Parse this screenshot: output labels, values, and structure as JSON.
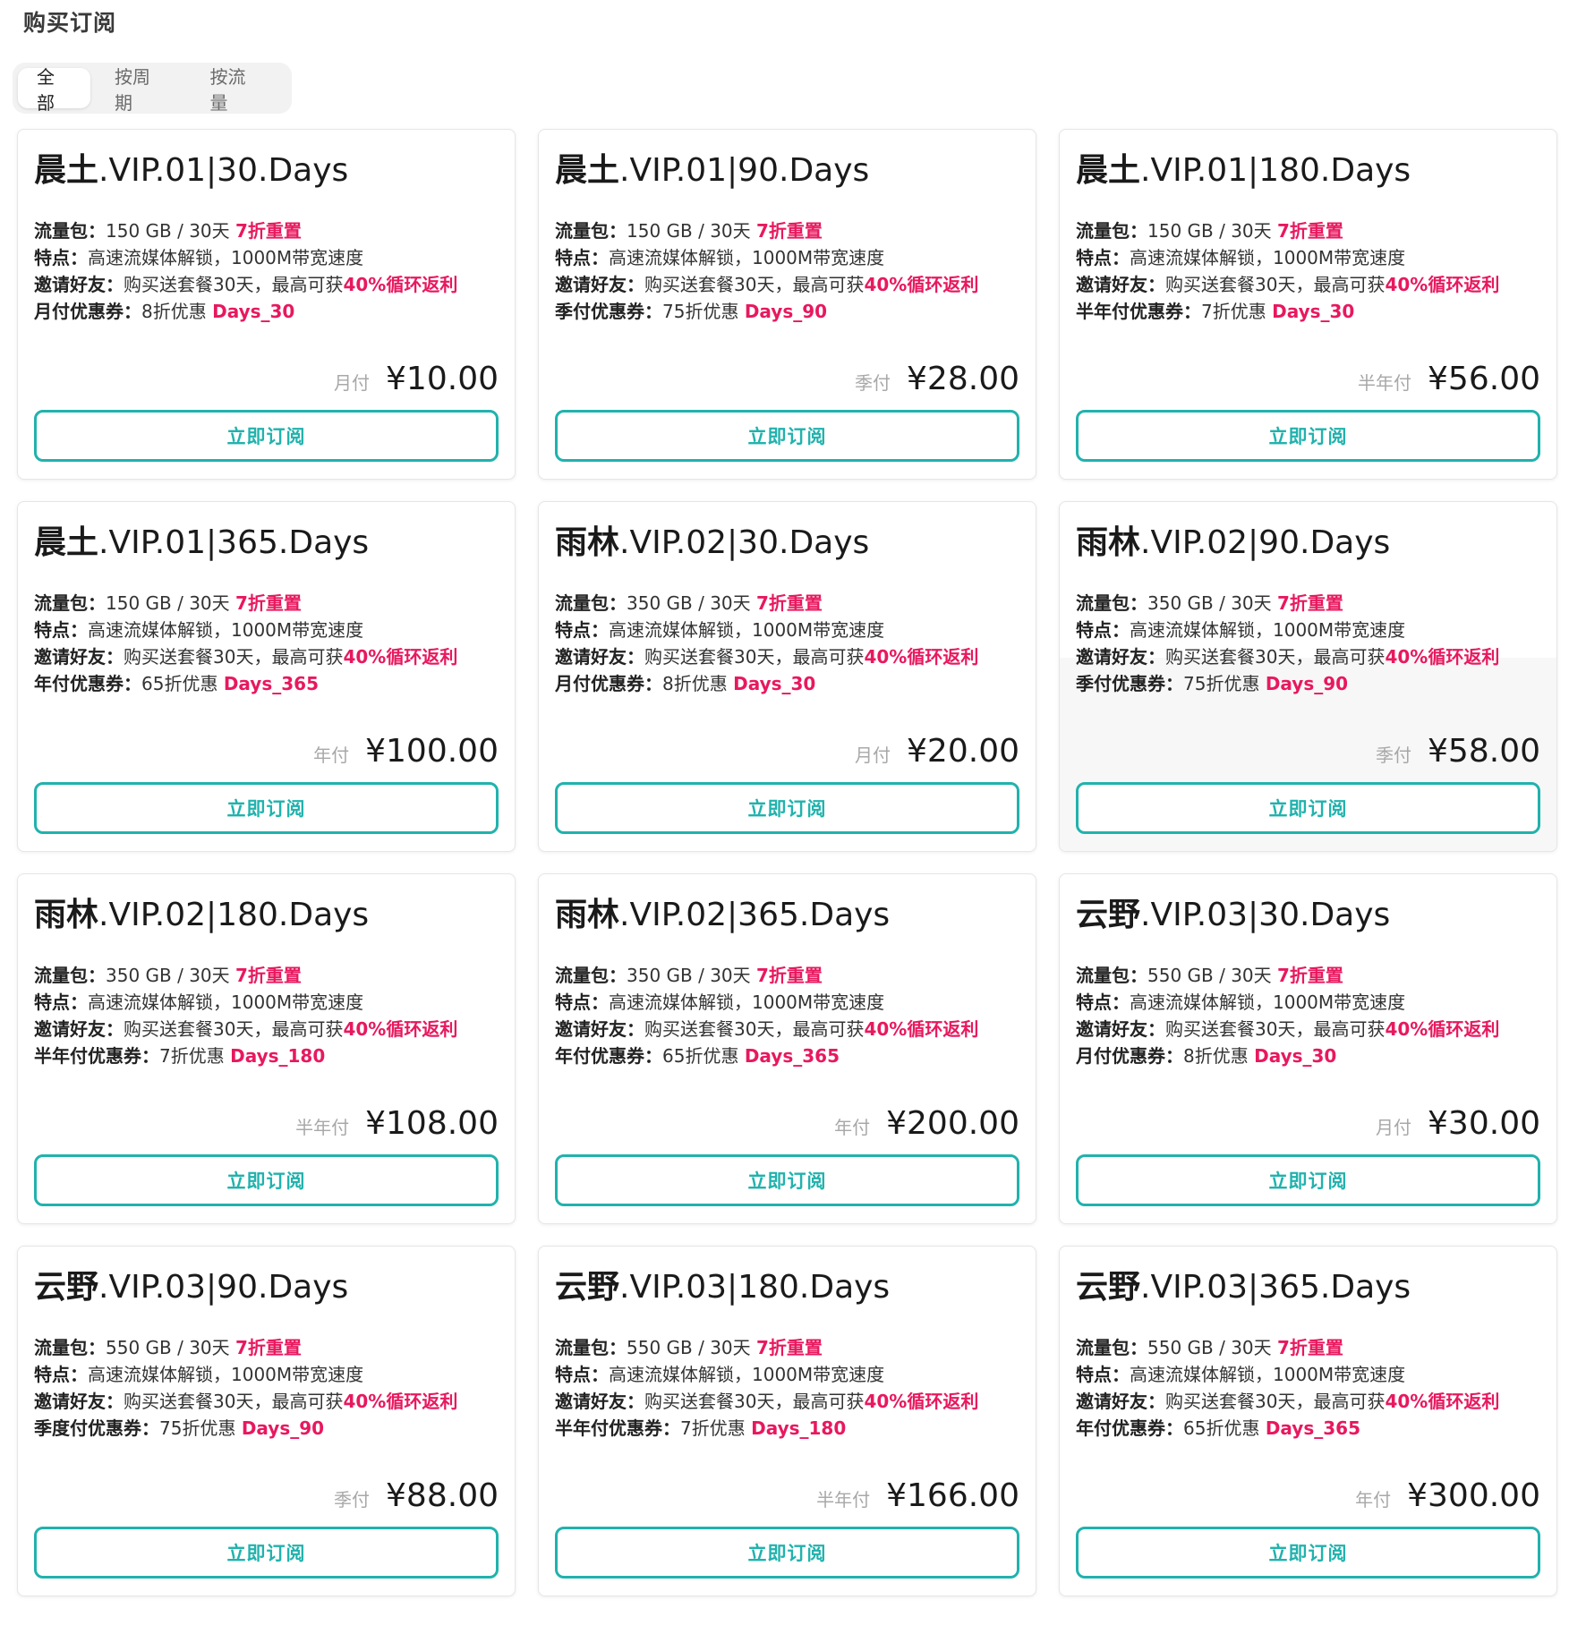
{
  "page": {
    "title": "购买订阅"
  },
  "tabs": [
    {
      "label": "全部",
      "active": true
    },
    {
      "label": "按周期",
      "active": false
    },
    {
      "label": "按流量",
      "active": false
    }
  ],
  "colors": {
    "accent": "#21b2ad",
    "highlight": "#e8185f"
  },
  "labels": {
    "traffic_key": "流量包：",
    "features_key": "特点：",
    "invite_key": "邀请好友："
  },
  "plans": [
    {
      "title_cn": "晨土",
      "title_rest": ".VIP.01|30.Days",
      "traffic": "150 GB / 30天 ",
      "traffic_hl": "7折重置",
      "features": "高速流媒体解锁，1000M带宽速度",
      "invite": "购买送套餐30天，最高可获",
      "invite_hl": "40%循环返利",
      "coupon_key": "月付优惠券：",
      "coupon_text": "8折优惠 ",
      "coupon_code": "Days_30",
      "period": "月付",
      "price": "¥10.00",
      "button": "立即订阅"
    },
    {
      "title_cn": "晨土",
      "title_rest": ".VIP.01|90.Days",
      "traffic": "150 GB / 30天 ",
      "traffic_hl": "7折重置",
      "features": "高速流媒体解锁，1000M带宽速度",
      "invite": "购买送套餐30天，最高可获",
      "invite_hl": "40%循环返利",
      "coupon_key": "季付优惠券：",
      "coupon_text": "75折优惠 ",
      "coupon_code": "Days_90",
      "period": "季付",
      "price": "¥28.00",
      "button": "立即订阅"
    },
    {
      "title_cn": "晨土",
      "title_rest": ".VIP.01|180.Days",
      "traffic": "150 GB / 30天 ",
      "traffic_hl": "7折重置",
      "features": "高速流媒体解锁，1000M带宽速度",
      "invite": "购买送套餐30天，最高可获",
      "invite_hl": "40%循环返利",
      "coupon_key": "半年付优惠券：",
      "coupon_text": "7折优惠 ",
      "coupon_code": "Days_30",
      "period": "半年付",
      "price": "¥56.00",
      "button": "立即订阅"
    },
    {
      "title_cn": "晨土",
      "title_rest": ".VIP.01|365.Days",
      "traffic": "150 GB / 30天 ",
      "traffic_hl": "7折重置",
      "features": "高速流媒体解锁，1000M带宽速度",
      "invite": "购买送套餐30天，最高可获",
      "invite_hl": "40%循环返利",
      "coupon_key": "年付优惠券：",
      "coupon_text": "65折优惠 ",
      "coupon_code": "Days_365",
      "period": "年付",
      "price": "¥100.00",
      "button": "立即订阅"
    },
    {
      "title_cn": "雨林",
      "title_rest": ".VIP.02|30.Days",
      "traffic": "350 GB / 30天 ",
      "traffic_hl": "7折重置",
      "features": "高速流媒体解锁，1000M带宽速度",
      "invite": "购买送套餐30天，最高可获",
      "invite_hl": "40%循环返利",
      "coupon_key": "月付优惠券：",
      "coupon_text": "8折优惠 ",
      "coupon_code": "Days_30",
      "period": "月付",
      "price": "¥20.00",
      "button": "立即订阅"
    },
    {
      "title_cn": "雨林",
      "title_rest": ".VIP.02|90.Days",
      "traffic": "350 GB / 30天 ",
      "traffic_hl": "7折重置",
      "features": "高速流媒体解锁，1000M带宽速度",
      "invite": "购买送套餐30天，最高可获",
      "invite_hl": "40%循环返利",
      "coupon_key": "季付优惠券：",
      "coupon_text": "75折优惠 ",
      "coupon_code": "Days_90",
      "period": "季付",
      "price": "¥58.00",
      "button": "立即订阅",
      "hovered": true
    },
    {
      "title_cn": "雨林",
      "title_rest": ".VIP.02|180.Days",
      "traffic": "350 GB / 30天 ",
      "traffic_hl": "7折重置",
      "features": "高速流媒体解锁，1000M带宽速度",
      "invite": "购买送套餐30天，最高可获",
      "invite_hl": "40%循环返利",
      "coupon_key": "半年付优惠券：",
      "coupon_text": "7折优惠 ",
      "coupon_code": "Days_180",
      "period": "半年付",
      "price": "¥108.00",
      "button": "立即订阅"
    },
    {
      "title_cn": "雨林",
      "title_rest": ".VIP.02|365.Days",
      "traffic": "350 GB / 30天 ",
      "traffic_hl": "7折重置",
      "features": "高速流媒体解锁，1000M带宽速度",
      "invite": "购买送套餐30天，最高可获",
      "invite_hl": "40%循环返利",
      "coupon_key": "年付优惠券：",
      "coupon_text": "65折优惠 ",
      "coupon_code": "Days_365",
      "period": "年付",
      "price": "¥200.00",
      "button": "立即订阅"
    },
    {
      "title_cn": "云野",
      "title_rest": ".VIP.03|30.Days",
      "traffic": "550 GB / 30天 ",
      "traffic_hl": "7折重置",
      "features": "高速流媒体解锁，1000M带宽速度",
      "invite": "购买送套餐30天，最高可获",
      "invite_hl": "40%循环返利",
      "coupon_key": "月付优惠券：",
      "coupon_text": "8折优惠 ",
      "coupon_code": "Days_30",
      "period": "月付",
      "price": "¥30.00",
      "button": "立即订阅"
    },
    {
      "title_cn": "云野",
      "title_rest": ".VIP.03|90.Days",
      "traffic": "550 GB / 30天 ",
      "traffic_hl": "7折重置",
      "features": "高速流媒体解锁，1000M带宽速度",
      "invite": "购买送套餐30天，最高可获",
      "invite_hl": "40%循环返利",
      "coupon_key": "季度付优惠券：",
      "coupon_text": "75折优惠 ",
      "coupon_code": "Days_90",
      "period": "季付",
      "price": "¥88.00",
      "button": "立即订阅"
    },
    {
      "title_cn": "云野",
      "title_rest": ".VIP.03|180.Days",
      "traffic": "550 GB / 30天 ",
      "traffic_hl": "7折重置",
      "features": "高速流媒体解锁，1000M带宽速度",
      "invite": "购买送套餐30天，最高可获",
      "invite_hl": "40%循环返利",
      "coupon_key": "半年付优惠券：",
      "coupon_text": "7折优惠 ",
      "coupon_code": "Days_180",
      "period": "半年付",
      "price": "¥166.00",
      "button": "立即订阅"
    },
    {
      "title_cn": "云野",
      "title_rest": ".VIP.03|365.Days",
      "traffic": "550 GB / 30天 ",
      "traffic_hl": "7折重置",
      "features": "高速流媒体解锁，1000M带宽速度",
      "invite": "购买送套餐30天，最高可获",
      "invite_hl": "40%循环返利",
      "coupon_key": "年付优惠券：",
      "coupon_text": "65折优惠 ",
      "coupon_code": "Days_365",
      "period": "年付",
      "price": "¥300.00",
      "button": "立即订阅"
    }
  ]
}
